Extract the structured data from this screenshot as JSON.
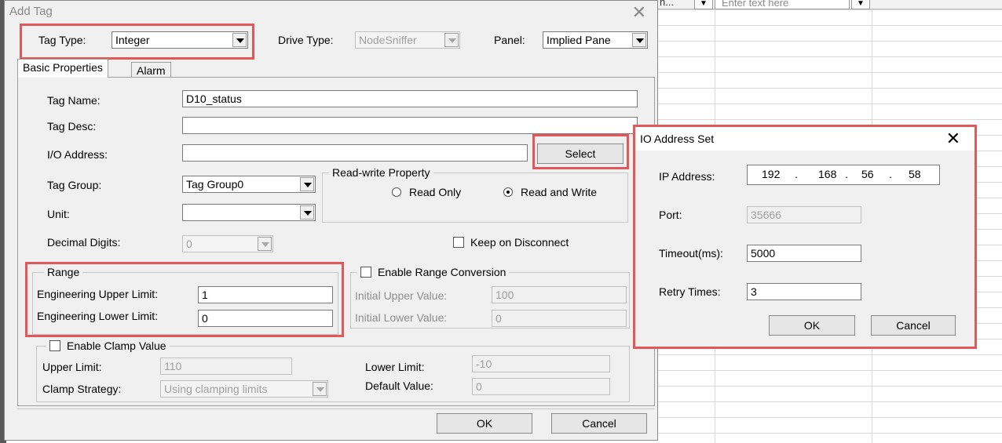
{
  "background": {
    "filter_cell_fragment": "n...",
    "filter_placeholder": "Enter text here"
  },
  "add_tag": {
    "title": "Add Tag",
    "close_glyph": "✕",
    "tag_type_label": "Tag Type:",
    "tag_type_value": "Integer",
    "drive_type_label": "Drive Type:",
    "drive_type_value": "NodeSniffer",
    "panel_label": "Panel:",
    "panel_value": "Implied Pane",
    "tabs": [
      "Basic Properties",
      "Alarm"
    ],
    "tag_name_label": "Tag Name:",
    "tag_name_value": "D10_status",
    "tag_desc_label": "Tag Desc:",
    "tag_desc_value": "",
    "io_address_label": "I/O Address:",
    "io_address_value": "",
    "select_label": "Select",
    "tag_group_label": "Tag Group:",
    "tag_group_value": "Tag Group0",
    "unit_label": "Unit:",
    "unit_value": "",
    "decimal_digits_label": "Decimal Digits:",
    "decimal_digits_value": "0",
    "rw_title": "Read-write Property",
    "read_only_label": "Read Only",
    "read_write_label": "Read and Write",
    "keep_on_disconnect_label": "Keep on Disconnect",
    "range_title": "Range",
    "eng_upper_label": "Engineering Upper Limit:",
    "eng_upper_value": "1",
    "eng_lower_label": "Engineering Lower Limit:",
    "eng_lower_value": "0",
    "range_conv_label": "Enable Range Conversion",
    "initial_upper_label": "Initial Upper Value:",
    "initial_upper_value": "100",
    "initial_lower_label": "Initial Lower Value:",
    "initial_lower_value": "0",
    "clamp_label": "Enable Clamp Value",
    "upper_limit_label": "Upper Limit:",
    "upper_limit_value": "110",
    "lower_limit_label": "Lower Limit:",
    "lower_limit_value": "-10",
    "clamp_strategy_label": "Clamp Strategy:",
    "clamp_strategy_value": "Using clamping limits",
    "default_value_label": "Default Value:",
    "default_value_value": "0",
    "ok_label": "OK",
    "cancel_label": "Cancel"
  },
  "io_dialog": {
    "title": "IO Address Set",
    "close_glyph": "✕",
    "ip_label": "IP Address:",
    "ip": [
      "192",
      "168",
      "56",
      "58"
    ],
    "ip_dot": ".",
    "port_label": "Port:",
    "port_value": "35666",
    "timeout_label": "Timeout(ms):",
    "timeout_value": "5000",
    "retry_label": "Retry Times:",
    "retry_value": "3",
    "ok_label": "OK",
    "cancel_label": "Cancel"
  },
  "colors": {
    "highlight": "#e25858",
    "dialog_bg": "#f0f0f0"
  }
}
